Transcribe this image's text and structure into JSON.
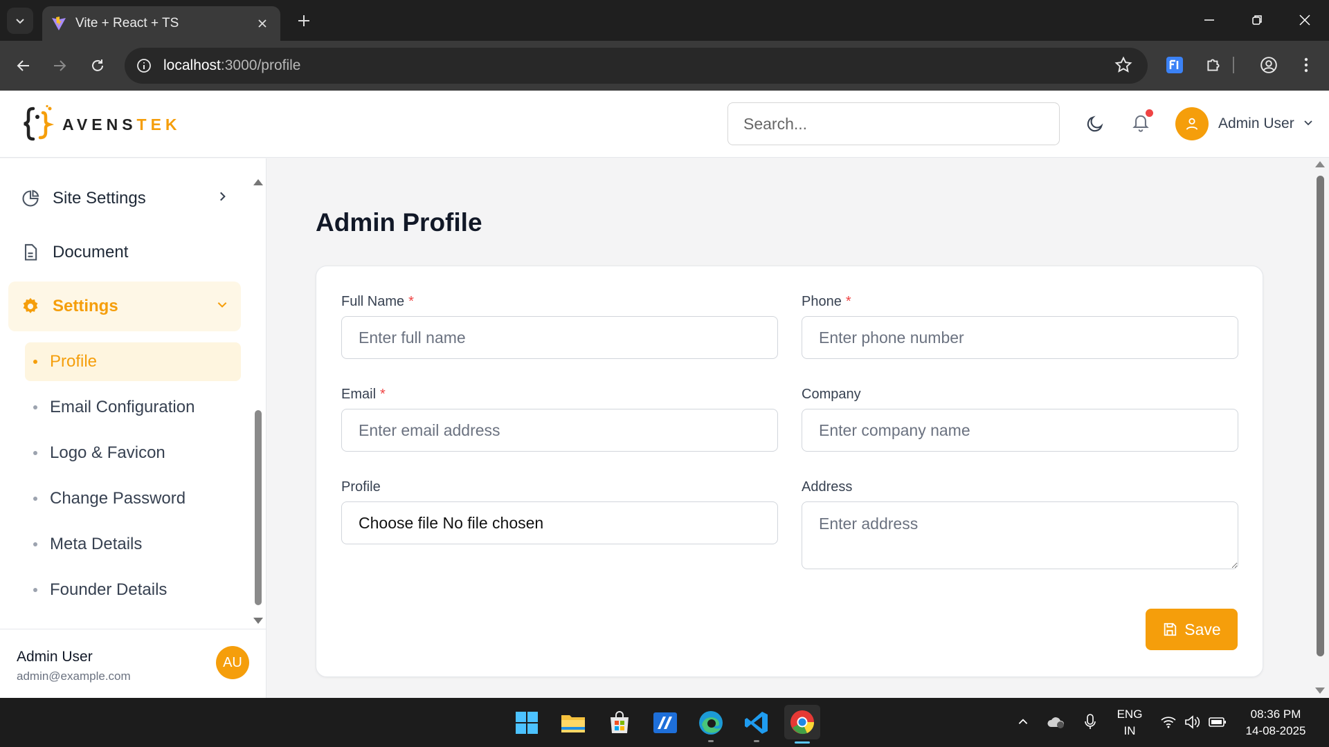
{
  "browser": {
    "tab_title": "Vite + React + TS",
    "url_host": "localhost",
    "url_path": ":3000/profile"
  },
  "header": {
    "logo_text_dark": "AVENS",
    "logo_text_accent": "TEK",
    "search_placeholder": "Search...",
    "user_name": "Admin User"
  },
  "sidebar": {
    "items": [
      {
        "label": "Site Settings"
      },
      {
        "label": "Document"
      },
      {
        "label": "Settings"
      }
    ],
    "sub_items": [
      {
        "label": "Profile"
      },
      {
        "label": "Email Configuration"
      },
      {
        "label": "Logo & Favicon"
      },
      {
        "label": "Change Password"
      },
      {
        "label": "Meta Details"
      },
      {
        "label": "Founder Details"
      }
    ],
    "footer": {
      "name": "Admin User",
      "email": "admin@example.com",
      "initials": "AU"
    }
  },
  "main": {
    "title": "Admin Profile",
    "form": {
      "full_name": {
        "label": "Full Name",
        "placeholder": "Enter full name"
      },
      "phone": {
        "label": "Phone",
        "placeholder": "Enter phone number"
      },
      "email": {
        "label": "Email",
        "placeholder": "Enter email address"
      },
      "company": {
        "label": "Company",
        "placeholder": "Enter company name"
      },
      "profile": {
        "label": "Profile",
        "value": "Choose file No file chosen"
      },
      "address": {
        "label": "Address",
        "placeholder": "Enter address"
      },
      "required_mark": "*",
      "save_label": "Save"
    }
  },
  "taskbar": {
    "lang_1": "ENG",
    "lang_2": "IN",
    "time": "08:36 PM",
    "date": "14-08-2025"
  },
  "colors": {
    "accent": "#f59e0b",
    "required": "#ef4444"
  }
}
